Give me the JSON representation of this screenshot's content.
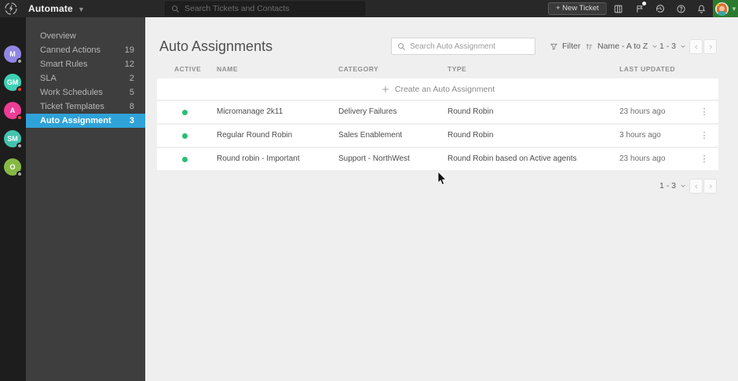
{
  "topbar": {
    "app_name": "Automate",
    "search_placeholder": "Search Tickets and Contacts",
    "new_ticket_label": "+ New Ticket",
    "icons": [
      "kanban-board",
      "activity-log",
      "history",
      "help",
      "notifications"
    ],
    "user_block_color": "#2b7a30"
  },
  "user_rail": {
    "avatars": [
      {
        "initials": "M",
        "color": "#9187e3",
        "status_color": "#a8a8a8"
      },
      {
        "initials": "GM",
        "color": "#3ed0b5",
        "status_color": "#e8413c"
      },
      {
        "initials": "A",
        "color": "#ee3d96",
        "status_color": "#e8413c"
      },
      {
        "initials": "SM",
        "color": "#43c3ae",
        "status_color": "#a8a8a8"
      },
      {
        "initials": "O",
        "color": "#86b944",
        "status_color": "#a8a8a8"
      }
    ]
  },
  "sidebar": {
    "items": [
      {
        "label": "Overview",
        "count": ""
      },
      {
        "label": "Canned Actions",
        "count": "19"
      },
      {
        "label": "Smart Rules",
        "count": "12"
      },
      {
        "label": "SLA",
        "count": "2"
      },
      {
        "label": "Work Schedules",
        "count": "5"
      },
      {
        "label": "Ticket Templates",
        "count": "8"
      },
      {
        "label": "Auto Assignment",
        "count": "3"
      }
    ],
    "selected_index": 6,
    "selected_color": "#2fa3d9"
  },
  "main": {
    "title": "Auto Assignments",
    "search_placeholder": "Search Auto Assignment",
    "filter_label": "Filter",
    "sort_label": "Name - A to Z",
    "pagination_label": "1 - 3",
    "table": {
      "columns": {
        "active": "ACTIVE",
        "name": "NAME",
        "category": "CATEGORY",
        "type": "TYPE",
        "last_updated": "LAST UPDATED"
      },
      "create_row_label": "Create an Auto Assignment",
      "active_dot_color": "#27bf73",
      "rows": [
        {
          "name": "Micromanage 2k11",
          "category": "Delivery Failures",
          "type": "Round Robin",
          "last_updated": "23 hours ago"
        },
        {
          "name": "Regular Round Robin",
          "category": "Sales Enablement",
          "type": "Round Robin",
          "last_updated": "3 hours ago"
        },
        {
          "name": "Round robin - Important",
          "category": "Support - NorthWest",
          "type": "Round Robin based on Active agents",
          "last_updated": "23 hours ago"
        }
      ]
    }
  }
}
